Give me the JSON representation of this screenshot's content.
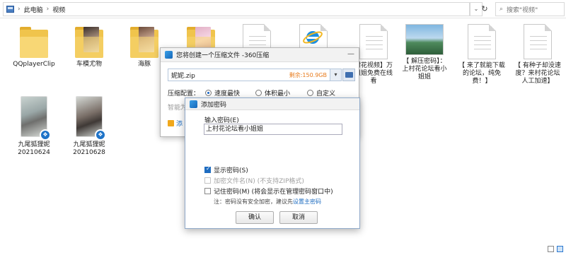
{
  "address_bar": {
    "breadcrumb": [
      "此电脑",
      "视频"
    ],
    "search_placeholder": "搜索\"视频\""
  },
  "files": [
    {
      "name": "QQplayerClip",
      "kind": "folder"
    },
    {
      "name": "车模尤物",
      "kind": "folder"
    },
    {
      "name": "海豚",
      "kind": "folder"
    },
    {
      "name": "",
      "kind": "folder"
    },
    {
      "name": "",
      "kind": "document"
    },
    {
      "name": "",
      "kind": "ie-document"
    },
    {
      "name": "村花视频】万\n姐姐免费在线\n看",
      "kind": "document"
    },
    {
      "name": "【 解压密码】：\n上村花论坛看小\n姐姐",
      "kind": "image"
    },
    {
      "name": "【 来了就能下载\n的论坛，纯免\n费！】",
      "kind": "document"
    },
    {
      "name": "【 有种子却没速\n度？来村花论坛\n人工加速】",
      "kind": "document"
    },
    {
      "name": "九尾狐狸妮\n20210624",
      "kind": "video"
    },
    {
      "name": "九尾狐狸妮\n20210628",
      "kind": "video"
    }
  ],
  "compress_dialog": {
    "title": "您将创建一个压缩文件 -360压缩",
    "filename": "妮妮.zip",
    "remaining": "剩余:150.9GB",
    "config_label": "压缩配置：",
    "options": [
      "速度最快",
      "体积最小",
      "自定义"
    ],
    "selected_option": "速度最快",
    "smart_label": "智能为",
    "lock_label": "添"
  },
  "password_dialog": {
    "title": "添加密码",
    "prompt": "输入密码(E)",
    "password_value": "上村花论坛看小姐姐",
    "show_password": "显示密码(S)",
    "encrypt_names": "加密文件名(N) (不支持ZIP格式)",
    "remember_password": "记住密码(M) (将会显示在管理密码窗口中)",
    "note": "注：密码没有安全加密，建议先",
    "note_link": "设置主密码",
    "ok": "确认",
    "cancel": "取消"
  }
}
